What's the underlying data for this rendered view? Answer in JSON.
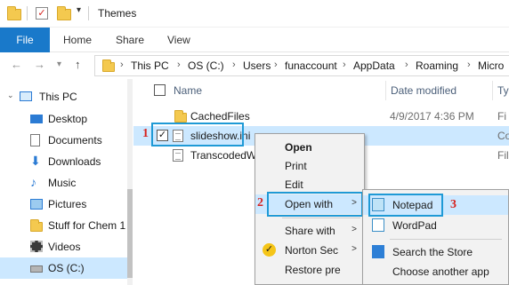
{
  "window": {
    "title": "Themes"
  },
  "ribbon": {
    "tabs": [
      "File",
      "Home",
      "Share",
      "View"
    ]
  },
  "address": {
    "crumbs": [
      "This PC",
      "OS (C:)",
      "Users",
      "funaccount",
      "AppData",
      "Roaming",
      "Micro"
    ]
  },
  "navpane": {
    "items": [
      {
        "label": "This PC",
        "icon": "pc-icon"
      },
      {
        "label": "Desktop",
        "icon": "desktop-icon"
      },
      {
        "label": "Documents",
        "icon": "documents-icon"
      },
      {
        "label": "Downloads",
        "icon": "downloads-icon"
      },
      {
        "label": "Music",
        "icon": "music-icon"
      },
      {
        "label": "Pictures",
        "icon": "pictures-icon"
      },
      {
        "label": "Stuff for Chem 1",
        "icon": "folder-icon"
      },
      {
        "label": "Videos",
        "icon": "videos-icon"
      },
      {
        "label": "OS (C:)",
        "icon": "drive-icon"
      }
    ]
  },
  "columns": {
    "name": "Name",
    "date": "Date modified",
    "type": "Ty"
  },
  "files": [
    {
      "name": "CachedFiles",
      "date": "4/9/2017 4:36 PM",
      "type": "Fi",
      "icon": "folder-icon"
    },
    {
      "name": "slideshow.ini",
      "date": "",
      "type": "Co",
      "icon": "file-icon",
      "checked": "✓"
    },
    {
      "name": "TranscodedW",
      "date": "",
      "type": "Fil",
      "icon": "file-icon"
    }
  ],
  "context_menu": {
    "items": [
      "Open",
      "Print",
      "Edit",
      "Open with",
      "Share with",
      "Norton Sec",
      "Restore pre"
    ]
  },
  "submenu": {
    "items": [
      "Notepad",
      "WordPad",
      "Search the Store",
      "Choose another app"
    ]
  },
  "steps": [
    "1",
    "2",
    "3"
  ],
  "colors": {
    "accent": "#1979ca",
    "highlight_box": "#1f9ad6",
    "step_label": "#d6221e",
    "selection": "#cce8ff"
  }
}
